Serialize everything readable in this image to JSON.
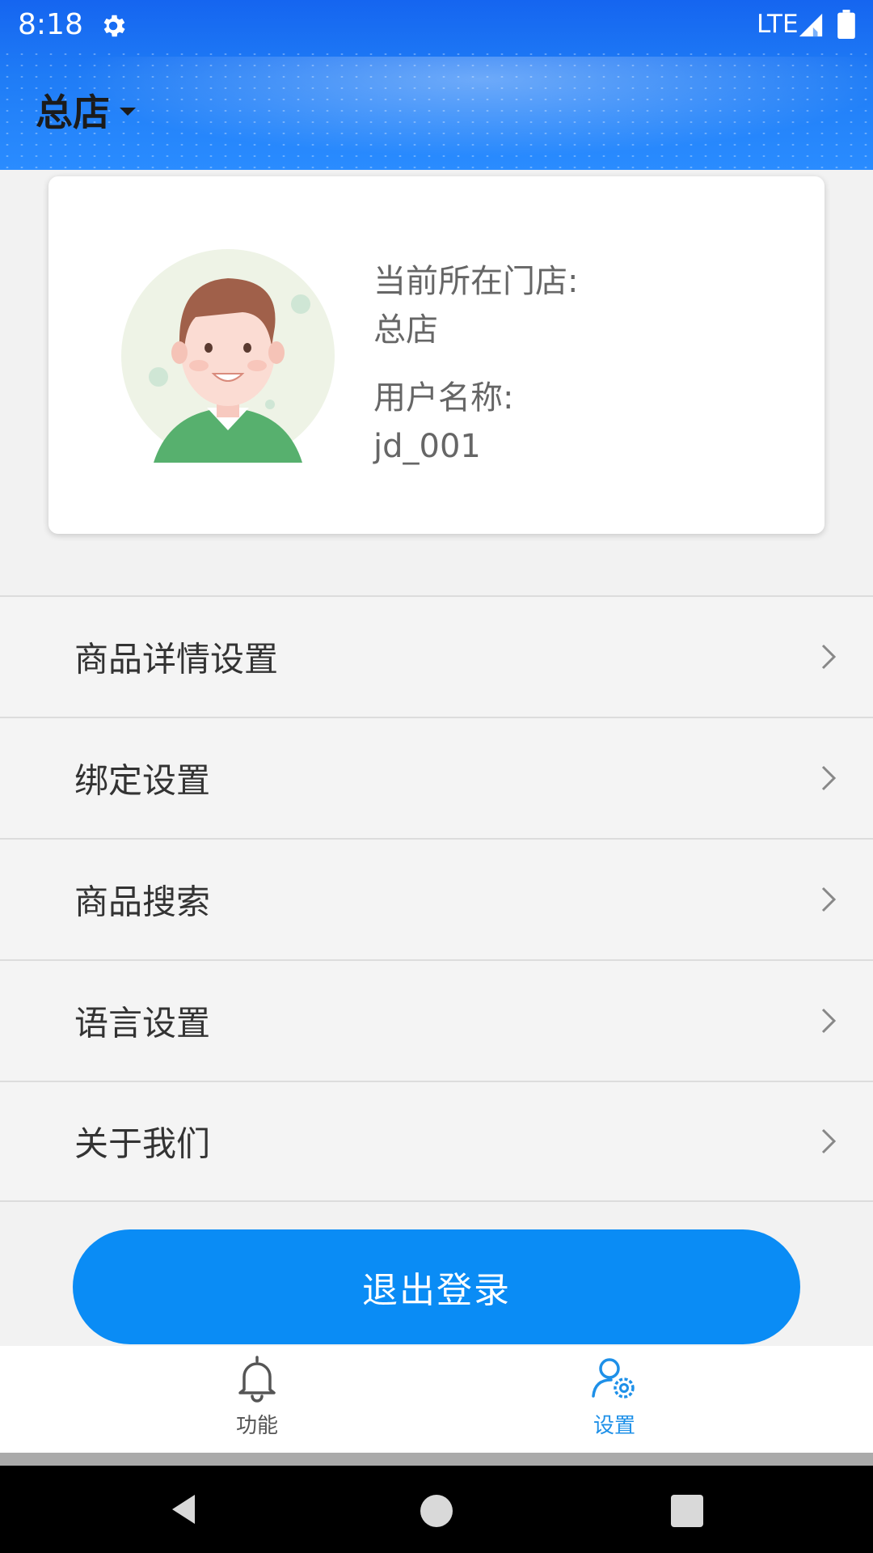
{
  "status_bar": {
    "time": "8:18",
    "network": "LTE",
    "icons": [
      "settings-gear-icon",
      "signal-icon",
      "battery-icon"
    ]
  },
  "header": {
    "store_name": "总店",
    "dropdown_icon": "caret-down-icon"
  },
  "profile": {
    "avatar_icon": "user-avatar-icon",
    "store_label": "当前所在门店:",
    "store_value": "总店",
    "user_label": "用户名称:",
    "user_value": "jd_001"
  },
  "menu": {
    "items": [
      {
        "label": "商品详情设置",
        "icon": "chevron-right-icon"
      },
      {
        "label": "绑定设置",
        "icon": "chevron-right-icon"
      },
      {
        "label": "商品搜索",
        "icon": "chevron-right-icon"
      },
      {
        "label": "语言设置",
        "icon": "chevron-right-icon"
      },
      {
        "label": "关于我们",
        "icon": "chevron-right-icon"
      }
    ]
  },
  "logout_label": "退出登录",
  "bottom_nav": {
    "items": [
      {
        "label": "功能",
        "icon": "bell-icon",
        "active": false
      },
      {
        "label": "设置",
        "icon": "user-settings-icon",
        "active": true
      }
    ]
  },
  "colors": {
    "header_blue": "#1f7cf6",
    "button_blue": "#0a8cf5",
    "active_nav": "#1e90e8"
  }
}
